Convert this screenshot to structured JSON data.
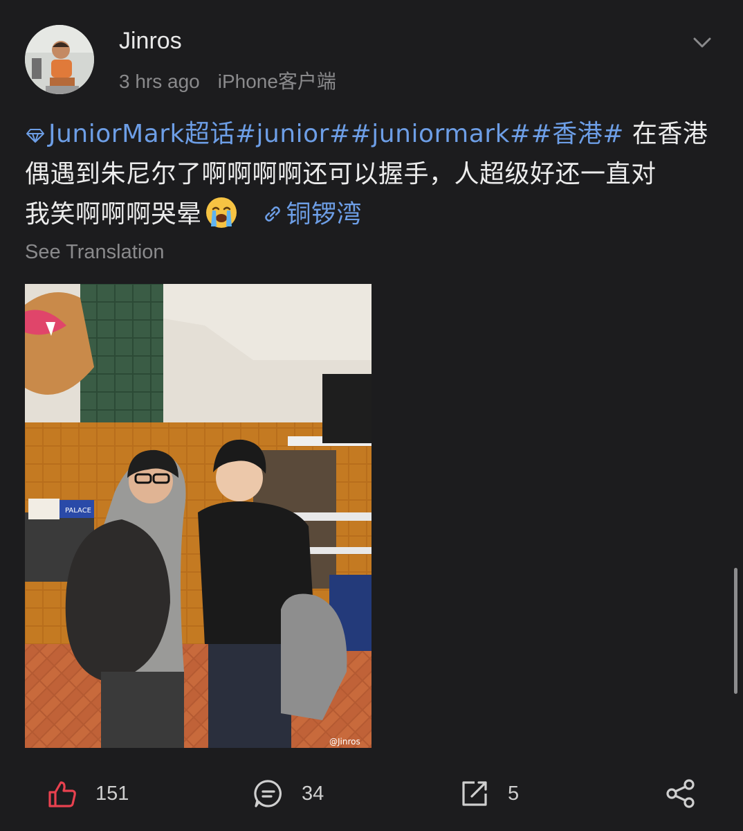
{
  "post": {
    "username": "Jinros",
    "time_ago": "3 hrs ago",
    "device": "iPhone客户端",
    "topic_tags": "JuniorMark超话#junior##juniormark##香港#",
    "text_line1": " 在香港",
    "text_line2": "偶遇到朱尼尔了啊啊啊啊还可以握手，人超级好还一直对",
    "text_line3": "我笑啊啊啊哭晕",
    "emoji": "loudly-crying-face",
    "location": "铜锣湾",
    "see_translation": "See Translation",
    "photo_watermark": "@Jinros",
    "shirt_text": "PALACE"
  },
  "actions": {
    "likes": "151",
    "comments": "34",
    "reposts": "5"
  },
  "colors": {
    "background": "#1c1c1e",
    "link": "#6d9ee6",
    "like": "#e8414f",
    "muted": "#8a8a8c"
  }
}
